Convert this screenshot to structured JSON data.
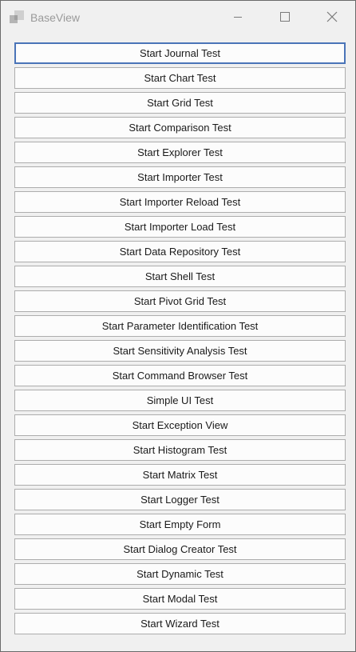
{
  "window": {
    "title": "BaseView",
    "icons": {
      "app": "app-logo-icon",
      "minimize": "minimize-icon",
      "maximize": "maximize-icon",
      "close": "close-icon"
    }
  },
  "buttons": [
    {
      "label": "Start Journal Test",
      "focused": true
    },
    {
      "label": "Start Chart Test"
    },
    {
      "label": "Start Grid Test"
    },
    {
      "label": "Start Comparison Test"
    },
    {
      "label": "Start Explorer Test"
    },
    {
      "label": "Start Importer Test"
    },
    {
      "label": "Start Importer Reload Test"
    },
    {
      "label": "Start Importer Load Test"
    },
    {
      "label": "Start Data Repository Test"
    },
    {
      "label": "Start Shell Test"
    },
    {
      "label": "Start Pivot Grid Test"
    },
    {
      "label": "Start Parameter Identification Test"
    },
    {
      "label": "Start Sensitivity Analysis Test"
    },
    {
      "label": "Start Command Browser Test"
    },
    {
      "label": "Simple UI Test"
    },
    {
      "label": "Start Exception View"
    },
    {
      "label": "Start Histogram Test"
    },
    {
      "label": "Start Matrix Test"
    },
    {
      "label": "Start Logger Test"
    },
    {
      "label": "Start Empty Form"
    },
    {
      "label": "Start Dialog Creator Test"
    },
    {
      "label": "Start Dynamic Test"
    },
    {
      "label": "Start Modal Test"
    },
    {
      "label": "Start Wizard Test"
    }
  ]
}
